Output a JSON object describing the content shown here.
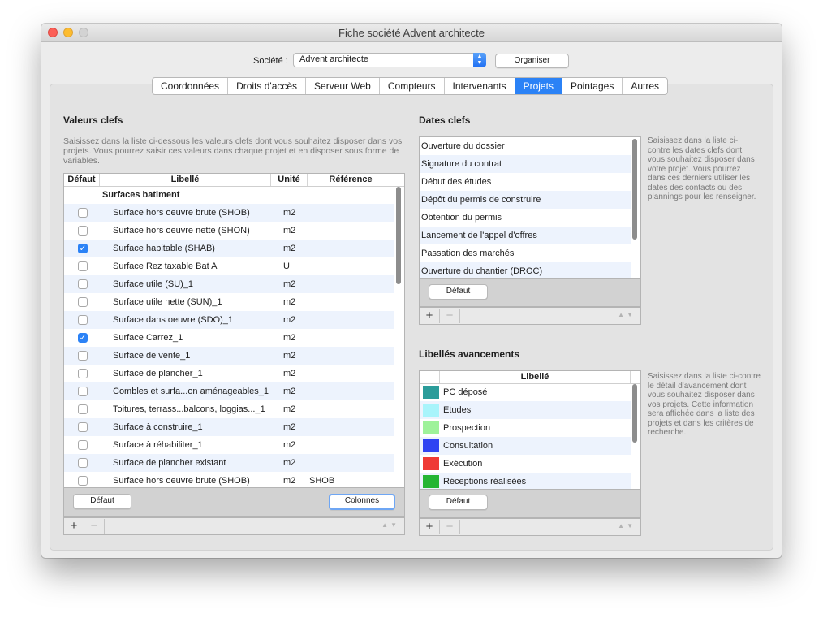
{
  "window": {
    "title": "Fiche société Advent architecte"
  },
  "top": {
    "societe_label": "Société :",
    "societe_value": "Advent architecte",
    "organiser_label": "Organiser"
  },
  "tabs": [
    {
      "label": "Coordonnées"
    },
    {
      "label": "Droits d'accès"
    },
    {
      "label": "Serveur Web"
    },
    {
      "label": "Compteurs"
    },
    {
      "label": "Intervenants"
    },
    {
      "label": "Projets",
      "active": true
    },
    {
      "label": "Pointages"
    },
    {
      "label": "Autres"
    }
  ],
  "valeurs": {
    "title": "Valeurs clefs",
    "help": "Saisissez dans la liste ci-dessous les valeurs clefs dont vous souhaitez disposer dans vos projets. Vous pourrez saisir ces valeurs dans chaque projet et en disposer sous forme de variables.",
    "columns": [
      "Défaut",
      "Libellé",
      "Unité",
      "Référence"
    ],
    "group": "Surfaces batiment",
    "rows": [
      {
        "checked": false,
        "libelle": "Surface hors oeuvre brute (SHOB)",
        "unite": "m2",
        "reference": ""
      },
      {
        "checked": false,
        "libelle": "Surface hors oeuvre nette (SHON)",
        "unite": "m2",
        "reference": ""
      },
      {
        "checked": true,
        "libelle": "Surface habitable (SHAB)",
        "unite": "m2",
        "reference": ""
      },
      {
        "checked": false,
        "libelle": "Surface Rez taxable Bat A",
        "unite": "U",
        "reference": ""
      },
      {
        "checked": false,
        "libelle": "Surface utile (SU)_1",
        "unite": "m2",
        "reference": ""
      },
      {
        "checked": false,
        "libelle": "Surface utile nette (SUN)_1",
        "unite": "m2",
        "reference": ""
      },
      {
        "checked": false,
        "libelle": "Surface dans oeuvre (SDO)_1",
        "unite": "m2",
        "reference": ""
      },
      {
        "checked": true,
        "libelle": "Surface Carrez_1",
        "unite": "m2",
        "reference": ""
      },
      {
        "checked": false,
        "libelle": "Surface de vente_1",
        "unite": "m2",
        "reference": ""
      },
      {
        "checked": false,
        "libelle": "Surface de plancher_1",
        "unite": "m2",
        "reference": ""
      },
      {
        "checked": false,
        "libelle": "Combles et surfa...on aménageables_1",
        "unite": "m2",
        "reference": ""
      },
      {
        "checked": false,
        "libelle": "Toitures, terrass...balcons, loggias..._1",
        "unite": "m2",
        "reference": ""
      },
      {
        "checked": false,
        "libelle": "Surface à construire_1",
        "unite": "m2",
        "reference": ""
      },
      {
        "checked": false,
        "libelle": "Surface à réhabiliter_1",
        "unite": "m2",
        "reference": ""
      },
      {
        "checked": false,
        "libelle": "Surface de plancher existant",
        "unite": "m2",
        "reference": ""
      },
      {
        "checked": false,
        "libelle": "Surface hors oeuvre brute (SHOB)",
        "unite": "m2",
        "reference": "SHOB"
      }
    ],
    "defaut_button": "Défaut",
    "colonnes_button": "Colonnes",
    "add_icon": "+",
    "remove_icon": "−"
  },
  "dates": {
    "title": "Dates clefs",
    "help": "Saisissez dans la liste ci-contre les dates clefs dont vous souhaitez disposer dans votre projet. Vous pourrez dans ces derniers utiliser les dates des contacts ou des plannings pour les renseigner.",
    "items": [
      "Ouverture du dossier",
      "Signature du contrat",
      "Début des études",
      "Dépôt du permis de construire",
      "Obtention du permis",
      "Lancement de l'appel d'offres",
      "Passation des marchés",
      "Ouverture du chantier (DROC)"
    ],
    "defaut_button": "Défaut",
    "add_icon": "+",
    "remove_icon": "−"
  },
  "avancements": {
    "title": "Libellés avancements",
    "help": "Saisissez dans la liste ci-contre le détail d'avancement dont vous souhaitez disposer dans vos projets. Cette information sera affichée dans la liste des projets et dans les critères de recherche.",
    "column": "Libellé",
    "items": [
      {
        "label": "PC déposé",
        "color": "#2b9c9a"
      },
      {
        "label": "Etudes",
        "color": "#a8f4fb"
      },
      {
        "label": "Prospection",
        "color": "#9ef29a"
      },
      {
        "label": "Consultation",
        "color": "#2f43f2"
      },
      {
        "label": "Exécution",
        "color": "#ef3a35"
      },
      {
        "label": "Réceptions réalisées",
        "color": "#24b533"
      }
    ],
    "defaut_button": "Défaut",
    "add_icon": "+",
    "remove_icon": "−"
  }
}
